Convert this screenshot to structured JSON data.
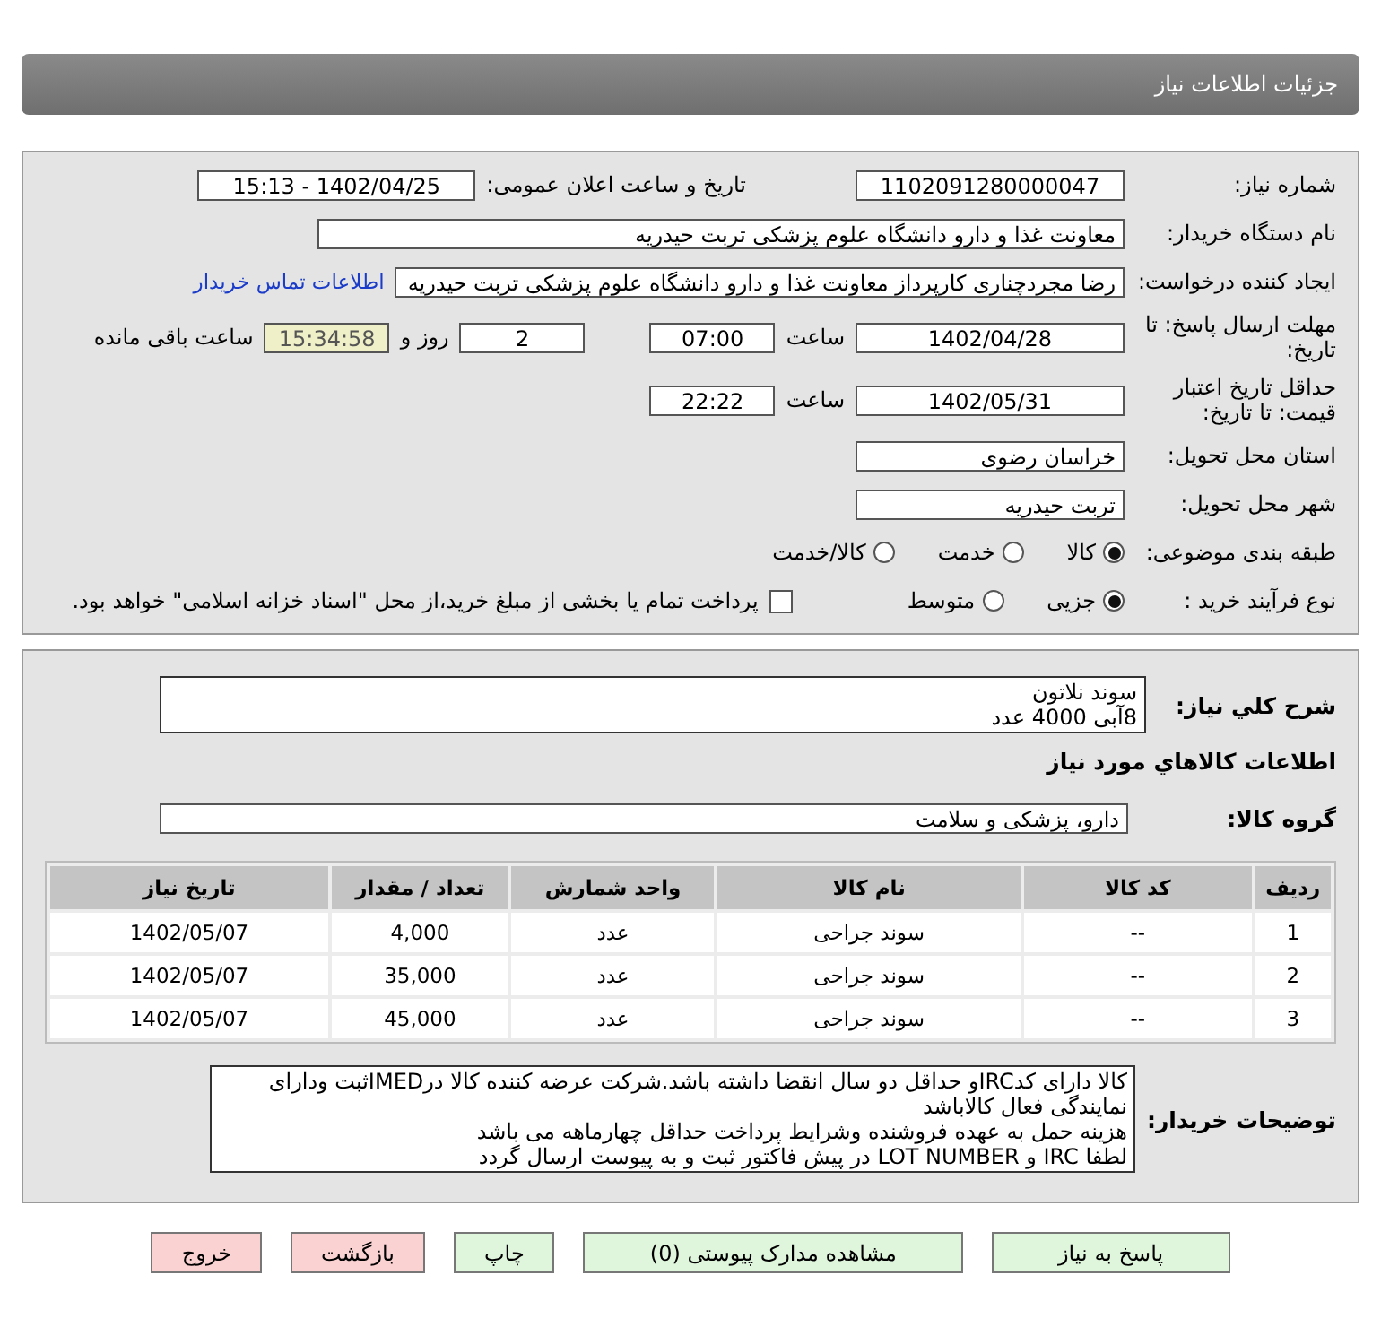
{
  "header": {
    "title": "جزئیات اطلاعات نیاز"
  },
  "form": {
    "need_number": {
      "label": "شماره نیاز:",
      "value": "1102091280000047"
    },
    "announce": {
      "label": "تاریخ و ساعت اعلان عمومی:",
      "value": "1402/04/25 - 15:13"
    },
    "buyer_org": {
      "label": "نام دستگاه خریدار:",
      "value": "معاونت غذا و دارو   دانشگاه علوم پزشکی تربت حیدریه"
    },
    "creator": {
      "label": "ایجاد کننده درخواست:",
      "value": "رضا مجردچناری کارپرداز معاونت غذا و دارو   دانشگاه علوم پزشکی تربت حیدریه",
      "link": "اطلاعات تماس خریدار"
    },
    "deadline": {
      "label": "مهلت ارسال پاسخ: تا تاریخ:",
      "date": "1402/04/28",
      "time_label": "ساعت",
      "time": "07:00",
      "days": "2",
      "days_label": "روز و",
      "remaining": "15:34:58",
      "remaining_label": "ساعت باقی مانده"
    },
    "validity": {
      "label": "حداقل تاریخ اعتبار قیمت: تا تاریخ:",
      "date": "1402/05/31",
      "time_label": "ساعت",
      "time": "22:22"
    },
    "province": {
      "label": "استان محل تحویل:",
      "value": "خراسان رضوی"
    },
    "city": {
      "label": "شهر محل تحویل:",
      "value": "تربت حیدریه"
    },
    "category": {
      "label": "طبقه بندی موضوعی:",
      "options": [
        {
          "label": "کالا",
          "selected": true
        },
        {
          "label": "خدمت",
          "selected": false
        },
        {
          "label": "کالا/خدمت",
          "selected": false
        }
      ]
    },
    "process": {
      "label": "نوع فرآیند خرید :",
      "options": [
        {
          "label": "جزیی",
          "selected": true
        },
        {
          "label": "متوسط",
          "selected": false
        }
      ],
      "treasury": {
        "label": "پرداخت تمام یا بخشی از مبلغ خرید،از محل \"اسناد خزانه اسلامی\" خواهد بود.",
        "checked": false
      }
    }
  },
  "items": {
    "summary": {
      "label": "شرح کلي نياز:",
      "lines": [
        "سوند نلاتون",
        "8آبی 4000 عدد"
      ]
    },
    "section_title": "اطلاعات کالاهاي مورد نياز",
    "group": {
      "label": "گروه کالا:",
      "value": "دارو، پزشکی و سلامت"
    },
    "table": {
      "columns": [
        "ردیف",
        "کد کالا",
        "نام کالا",
        "واحد شمارش",
        "تعداد / مقدار",
        "تاریخ نیاز"
      ],
      "rows": [
        [
          "1",
          "--",
          "سوند جراحی",
          "عدد",
          "4,000",
          "1402/05/07"
        ],
        [
          "2",
          "--",
          "سوند جراحی",
          "عدد",
          "35,000",
          "1402/05/07"
        ],
        [
          "3",
          "--",
          "سوند جراحی",
          "عدد",
          "45,000",
          "1402/05/07"
        ]
      ]
    },
    "notes": {
      "label": "توضیحات خریدار:",
      "lines": [
        "کالا دارای کدIRCو حداقل دو سال انقضا داشته باشد.شرکت عرضه کننده کالا درIMEDثبت ودارای",
        "نمایندگی فعال کالاباشد",
        "هزینه حمل به عهده فروشنده وشرایط پرداخت حداقل چهارماهه می باشد",
        "لطفا IRC و LOT NUMBER در پیش فاکتور ثبت و به پیوست ارسال گردد"
      ]
    }
  },
  "buttons": [
    {
      "label": "پاسخ به نیاز",
      "kind": "action"
    },
    {
      "label": "مشاهده مدارک پیوستی (0)",
      "kind": "action"
    },
    {
      "label": "چاپ",
      "kind": "action"
    },
    {
      "label": "بازگشت",
      "kind": "exit"
    },
    {
      "label": "خروج",
      "kind": "exit"
    }
  ]
}
